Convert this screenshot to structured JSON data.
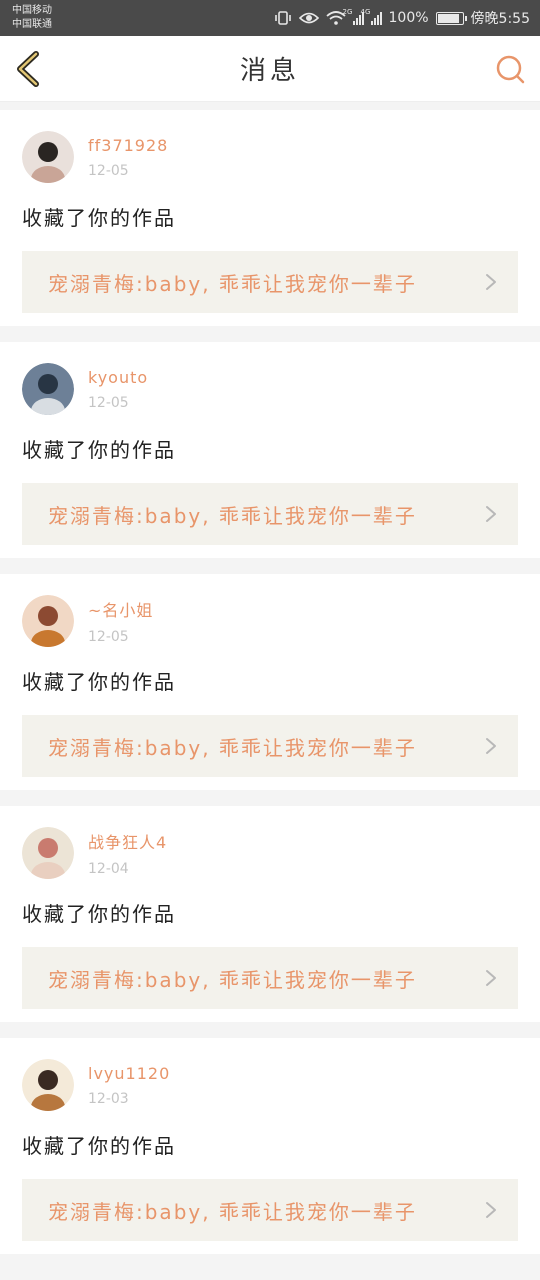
{
  "status": {
    "carrier1": "中国移动",
    "carrier2": "中国联通",
    "net1": "2G",
    "net2": "4G",
    "battery": "100%",
    "battery_level": 0.9,
    "time": "傍晚5:55"
  },
  "nav": {
    "title": "消息"
  },
  "messages": [
    {
      "user": "ff371928",
      "date": "12-05",
      "action": "收藏了你的作品",
      "work": "宠溺青梅:baby, 乖乖让我宠你一辈子",
      "avatar_colors": [
        "#e9e0db",
        "#2a2522",
        "#c9a597"
      ]
    },
    {
      "user": "kyouto",
      "date": "12-05",
      "action": "收藏了你的作品",
      "work": "宠溺青梅:baby, 乖乖让我宠你一辈子",
      "avatar_colors": [
        "#6d8097",
        "#283544",
        "#d8dde2"
      ]
    },
    {
      "user": "~名小姐",
      "date": "12-05",
      "action": "收藏了你的作品",
      "work": "宠溺青梅:baby, 乖乖让我宠你一辈子",
      "avatar_colors": [
        "#f1d8c5",
        "#8c4a32",
        "#c8782f"
      ]
    },
    {
      "user": "战争狂人4",
      "date": "12-04",
      "action": "收藏了你的作品",
      "work": "宠溺青梅:baby, 乖乖让我宠你一辈子",
      "avatar_colors": [
        "#ece4d6",
        "#c97b6f",
        "#e9cfc0"
      ]
    },
    {
      "user": "lvyu1120",
      "date": "12-03",
      "action": "收藏了你的作品",
      "work": "宠溺青梅:baby, 乖乖让我宠你一辈子",
      "avatar_colors": [
        "#f4ead9",
        "#3a2a22",
        "#b7773e"
      ]
    }
  ],
  "colors": {
    "accent": "#e8956a",
    "card_bg": "#ffffff",
    "work_bg": "#f3f2ec",
    "page_bg": "#f4f4f4"
  }
}
